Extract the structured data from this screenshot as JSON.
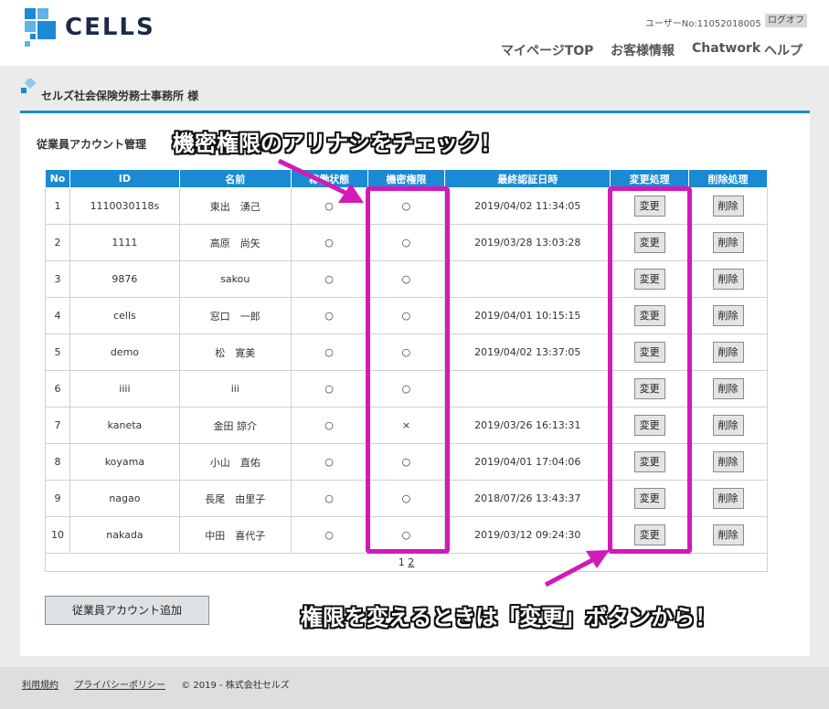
{
  "header": {
    "logo_text": "CELLS",
    "user_no": "ユーザーNo:11052018005",
    "logoff": "ログオフ",
    "nav": [
      "マイページTOP",
      "お客様情報",
      "Chatwork",
      "ヘルプ"
    ]
  },
  "company": "セルズ社会保険労務士事務所 様",
  "section_title": "従業員アカウント管理",
  "table": {
    "headers": [
      "No",
      "ID",
      "名前",
      "稼働状態",
      "機密権限",
      "最終認証日時",
      "変更処理",
      "削除処理"
    ],
    "rows": [
      {
        "no": "1",
        "id": "1110030118s",
        "name": "東出　湧己",
        "status": "○",
        "secret": "○",
        "last_auth": "2019/04/02 11:34:05"
      },
      {
        "no": "2",
        "id": "1111",
        "name": "高原　尚矢",
        "status": "○",
        "secret": "○",
        "last_auth": "2019/03/28 13:03:28"
      },
      {
        "no": "3",
        "id": "9876",
        "name": "sakou",
        "status": "○",
        "secret": "○",
        "last_auth": ""
      },
      {
        "no": "4",
        "id": "cells",
        "name": "窓口　一郎",
        "status": "○",
        "secret": "○",
        "last_auth": "2019/04/01 10:15:15"
      },
      {
        "no": "5",
        "id": "demo",
        "name": "松　寛美",
        "status": "○",
        "secret": "○",
        "last_auth": "2019/04/02 13:37:05"
      },
      {
        "no": "6",
        "id": "iiii",
        "name": "iii",
        "status": "○",
        "secret": "○",
        "last_auth": ""
      },
      {
        "no": "7",
        "id": "kaneta",
        "name": "金田 諒介",
        "status": "○",
        "secret": "×",
        "last_auth": "2019/03/26 16:13:31"
      },
      {
        "no": "8",
        "id": "koyama",
        "name": "小山　直佑",
        "status": "○",
        "secret": "○",
        "last_auth": "2019/04/01 17:04:06"
      },
      {
        "no": "9",
        "id": "nagao",
        "name": "長尾　由里子",
        "status": "○",
        "secret": "○",
        "last_auth": "2018/07/26 13:43:37"
      },
      {
        "no": "10",
        "id": "nakada",
        "name": "中田　喜代子",
        "status": "○",
        "secret": "○",
        "last_auth": "2019/03/12 09:24:30"
      }
    ],
    "edit_label": "変更",
    "delete_label": "削除"
  },
  "pager": {
    "current": "1",
    "next": "2"
  },
  "add_button": "従業員アカウント追加",
  "footer": {
    "terms": "利用規約",
    "privacy": "プライバシーポリシー",
    "copyright": "© 2019 - 株式会社セルズ"
  },
  "annotations": {
    "callout_top": "機密権限のアリナシをチェック！",
    "callout_bottom": "権限を変えるときは「変更」ボタンから！",
    "color": "#d21ab8"
  },
  "colors": {
    "accent": "#1a8ad4",
    "background": "#ebebeb"
  }
}
